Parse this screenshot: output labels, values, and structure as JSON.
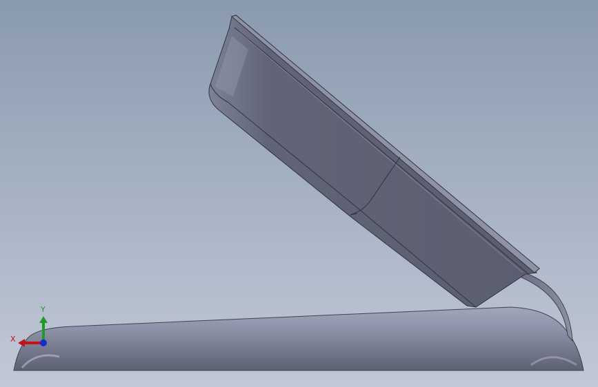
{
  "viewport": {
    "background_top": "#8a9aae",
    "background_bottom": "#c2c8d5",
    "model_color": "#5f6575"
  },
  "triad": {
    "x_label": "X",
    "y_label": "Y",
    "x_color": "#c0141c",
    "y_color": "#1f9a2a",
    "z_color": "#1a2ad0"
  }
}
